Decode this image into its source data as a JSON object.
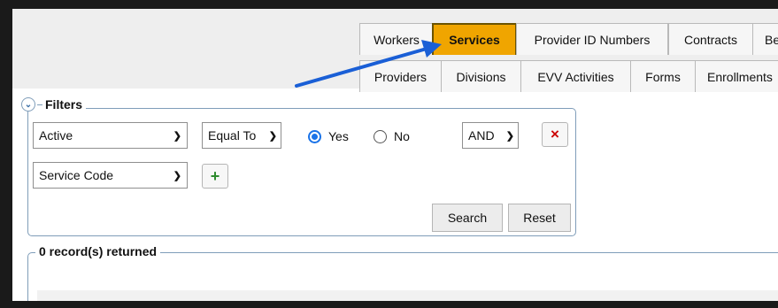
{
  "tabs_row1": [
    "Workers",
    "Services",
    "Provider ID Numbers",
    "Contracts",
    "Be"
  ],
  "active_tab": "Services",
  "tabs_row2": [
    "Providers",
    "Divisions",
    "EVV Activities",
    "Forms",
    "Enrollments"
  ],
  "filters": {
    "title": "Filters",
    "row1": {
      "field": "Active",
      "operator": "Equal To",
      "radio_yes": "Yes",
      "radio_no": "No",
      "selected": "Yes",
      "conjunction": "AND"
    },
    "row2": {
      "field": "Service Code"
    },
    "remove_icon": "×",
    "add_icon": "+",
    "search_label": "Search",
    "reset_label": "Reset"
  },
  "results": {
    "title": "0 record(s) returned"
  },
  "colors": {
    "active_tab": "#f0a500",
    "arrow": "#1a5fd6",
    "remove": "#cc0000",
    "add": "#2e8b2e"
  }
}
